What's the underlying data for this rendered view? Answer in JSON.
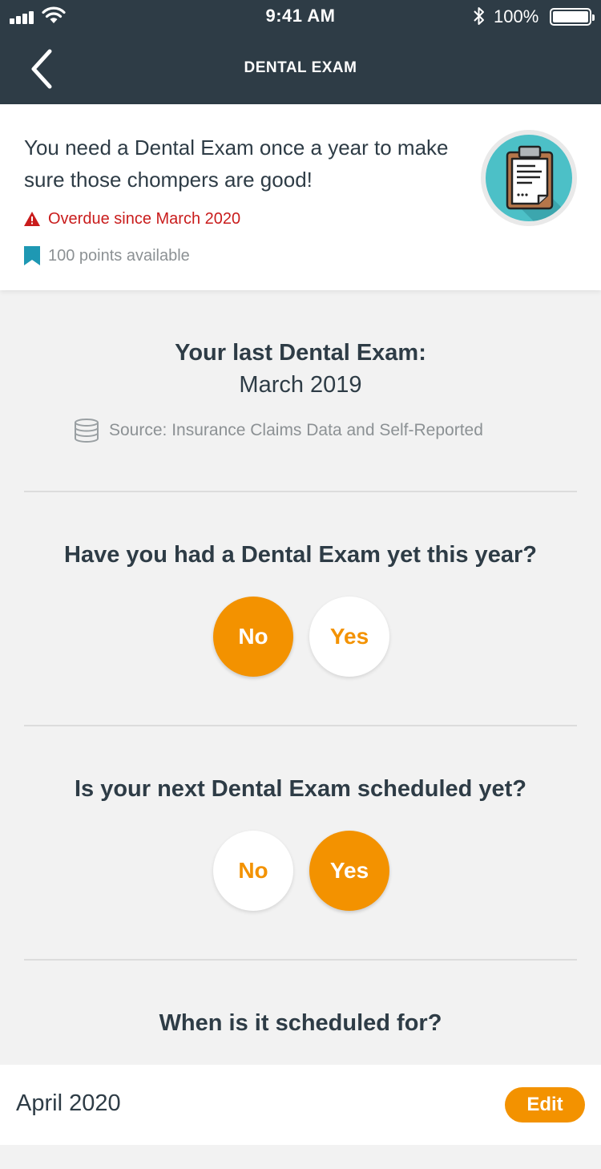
{
  "status_bar": {
    "time": "9:41 AM",
    "battery_percent": "100%",
    "icons": [
      "signal-icon",
      "wifi-icon",
      "bluetooth-icon",
      "battery-icon"
    ]
  },
  "nav": {
    "title": "DENTAL EXAM",
    "back_icon": "chevron-left-icon"
  },
  "info": {
    "description": "You need a Dental Exam once a year to make sure those chompers are good!",
    "overdue_text": "Overdue since March 2020",
    "points_text": "100 points available",
    "badge_icon": "clipboard-icon"
  },
  "last_exam": {
    "title": "Your last Dental Exam:",
    "date": "March 2019",
    "source": "Source: Insurance Claims Data and Self-Reported"
  },
  "q1": {
    "question": "Have you had a Dental Exam yet this year?",
    "no_label": "No",
    "yes_label": "Yes",
    "selected": "No"
  },
  "q2": {
    "question": "Is your next Dental Exam scheduled yet?",
    "no_label": "No",
    "yes_label": "Yes",
    "selected": "Yes"
  },
  "q3": {
    "question": "When is it scheduled for?",
    "value": "April 2020",
    "edit_label": "Edit"
  },
  "colors": {
    "header_bg": "#2e3c46",
    "accent_orange": "#f39200",
    "alert_red": "#c91c1c",
    "bookmark_teal": "#1e98b3",
    "badge_teal": "#4cc0c7"
  }
}
